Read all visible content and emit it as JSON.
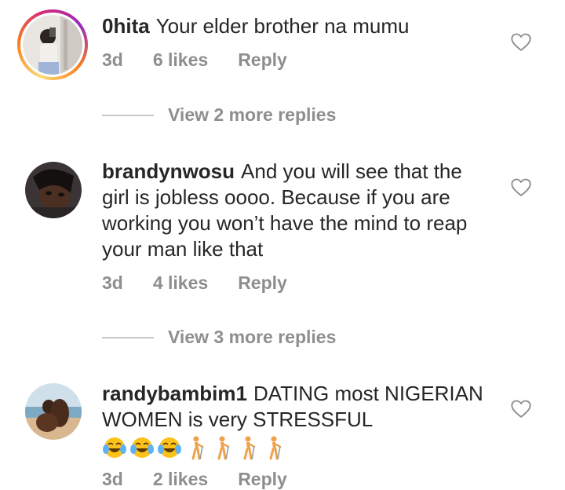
{
  "comments": [
    {
      "username": "0hita",
      "text": "Your elder brother na mumu",
      "age": "3d",
      "likes": "6 likes",
      "reply": "Reply",
      "view_more": "View 2 more replies"
    },
    {
      "username": "brandynwosu",
      "text": "And you will see that the girl is jobless oooo. Because if you are working you won’t have the mind to reap your man like that",
      "age": "3d",
      "likes": "4 likes",
      "reply": "Reply",
      "view_more": "View 3 more replies"
    },
    {
      "username": "randybambim1",
      "text": "DATING most NIGERIAN WOMEN is very STRESSFUL",
      "emoji": [
        "tears-of-joy",
        "tears-of-joy",
        "tears-of-joy",
        "person-walking-with-cane",
        "person-walking-with-cane",
        "person-walking-with-cane",
        "person-walking-with-cane"
      ],
      "age": "3d",
      "likes": "2 likes",
      "reply": "Reply"
    }
  ],
  "colors": {
    "text": "#262626",
    "secondary": "#8e8e8e",
    "divider": "#c7c7c7"
  }
}
